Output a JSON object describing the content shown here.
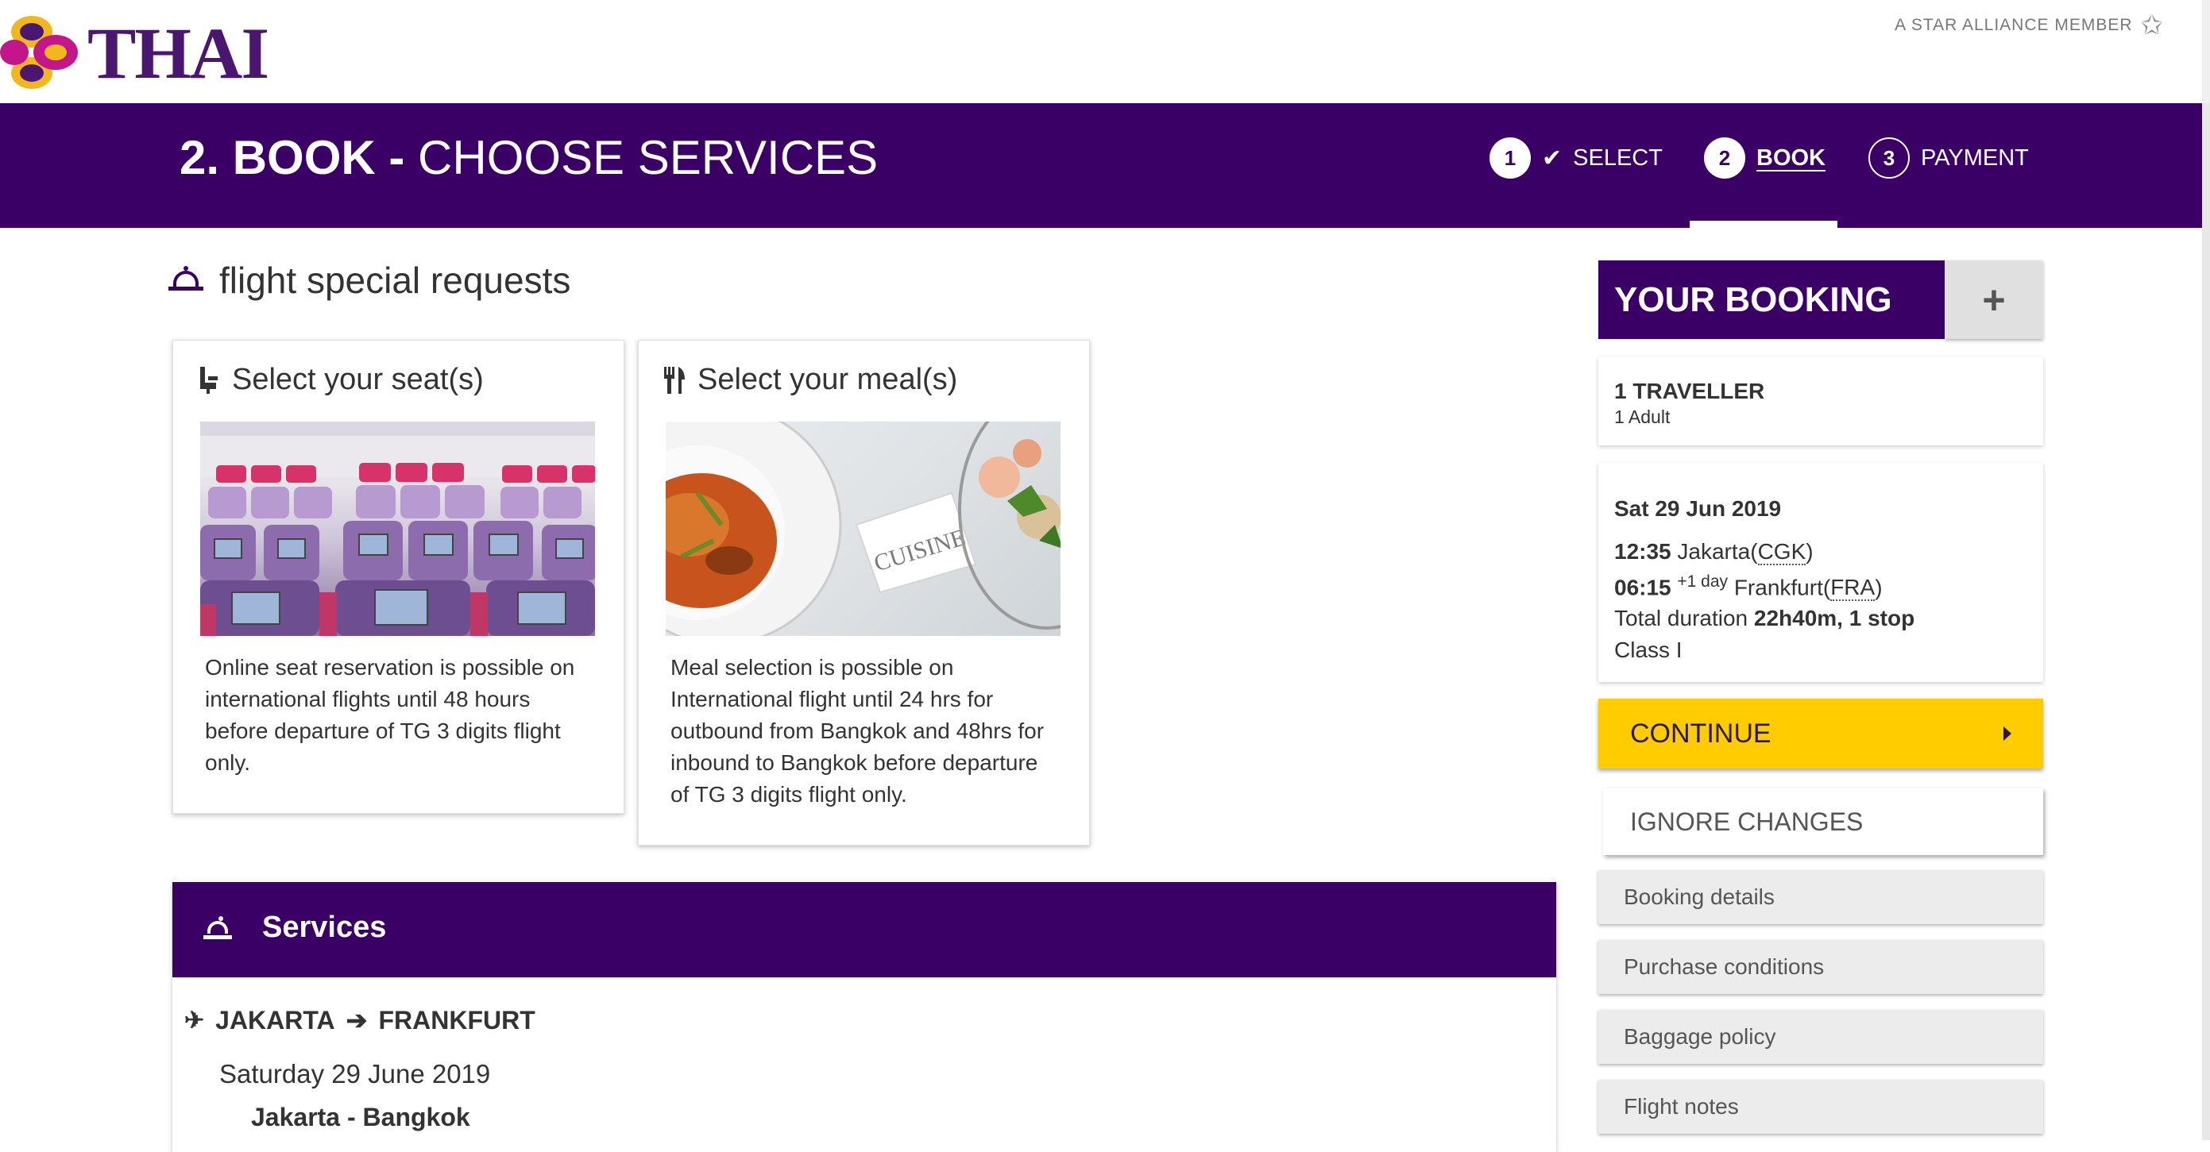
{
  "header": {
    "logo_text": "THAI",
    "alliance_text": "A STAR ALLIANCE MEMBER"
  },
  "title_bar": {
    "step_bold": "2. BOOK -",
    "step_rest": "CHOOSE SERVICES",
    "steps": [
      {
        "number": "1",
        "label": "SELECT",
        "state": "completed"
      },
      {
        "number": "2",
        "label": "BOOK",
        "state": "active"
      },
      {
        "number": "3",
        "label": "PAYMENT",
        "state": "upcoming"
      }
    ]
  },
  "special_requests": {
    "title": "flight special requests",
    "seat_card": {
      "title": "Select your seat(s)",
      "text": "Online seat reservation is possible on international flights until 48 hours before departure of TG 3 digits flight only."
    },
    "meal_card": {
      "title": "Select your meal(s)",
      "image_caption": "CUISINE",
      "text": "Meal selection is possible on International flight until 24 hrs for outbound from Bangkok and 48hrs for inbound to Bangkok before departure of TG 3 digits flight only."
    }
  },
  "services": {
    "title": "Services",
    "route_from": "JAKARTA",
    "route_to": "FRANKFURT",
    "date": "Saturday 29 June 2019",
    "leg": "Jakarta - Bangkok"
  },
  "booking": {
    "title": "YOUR BOOKING",
    "toggle": "+",
    "travellers": "1 TRAVELLER",
    "traveller_detail": "1 Adult",
    "date": "Sat 29 Jun 2019",
    "depart_time": "12:35",
    "depart_city": "Jakarta(",
    "depart_code": "CGK",
    "depart_close": ")",
    "arrive_time": "06:15",
    "arrive_offset": "+1 day",
    "arrive_city": "Frankfurt(",
    "arrive_code": "FRA",
    "arrive_close": ")",
    "duration_label": "Total duration",
    "duration_value": "22h40m, 1 stop",
    "class": "Class I",
    "continue_label": "CONTINUE",
    "ignore_label": "IGNORE CHANGES",
    "links": [
      "Booking details",
      "Purchase conditions",
      "Baggage policy",
      "Flight notes"
    ]
  },
  "colors": {
    "brand_purple": "#3b0066",
    "accent_yellow": "#ffcc00"
  }
}
